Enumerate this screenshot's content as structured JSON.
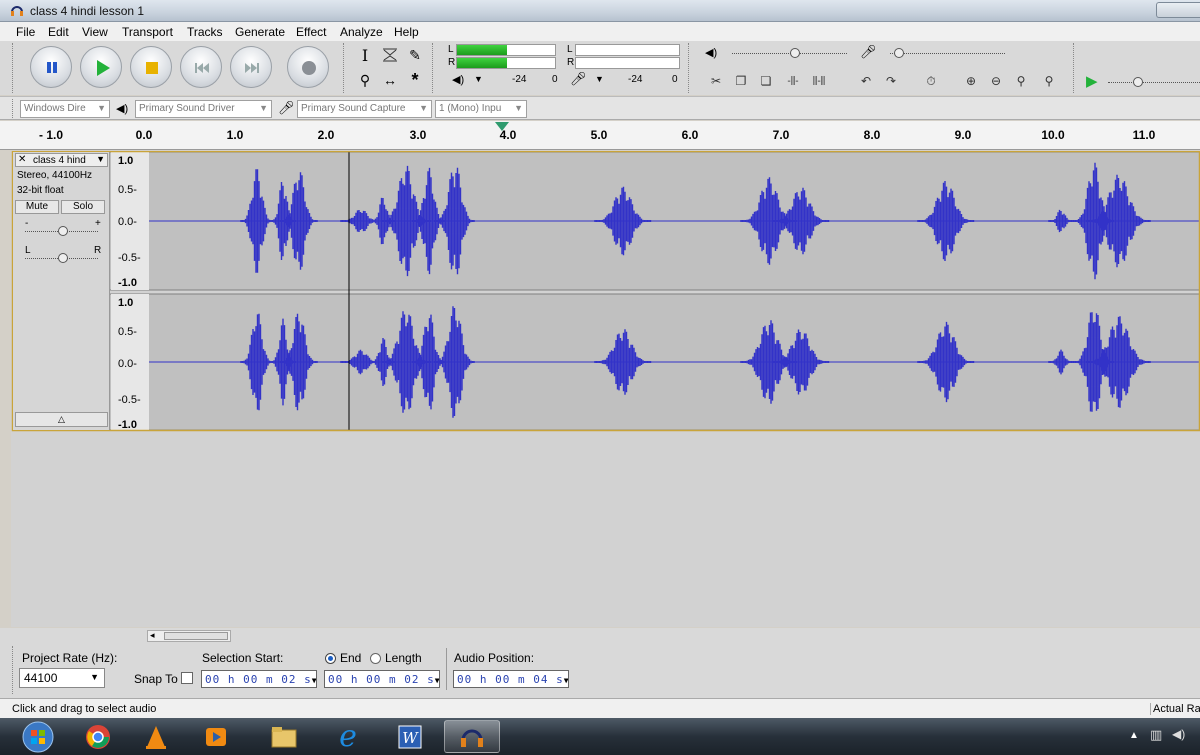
{
  "window": {
    "title": "class 4 hindi lesson 1"
  },
  "menu": [
    "File",
    "Edit",
    "View",
    "Transport",
    "Tracks",
    "Generate",
    "Effect",
    "Analyze",
    "Help"
  ],
  "meters": {
    "play_left_label": "L",
    "play_right_label": "R",
    "rec_left_label": "L",
    "rec_right_label": "R",
    "scale_a": "-24",
    "scale_b": "0",
    "scale_c": "-24",
    "scale_d": "0",
    "play_level": 0.85
  },
  "devices": {
    "host": "Windows Dire",
    "output": "Primary Sound Driver",
    "input": "Primary Sound Capture",
    "channels": "1 (Mono) Inpu"
  },
  "ruler": {
    "ticks": [
      "- 1.0",
      "0.0",
      "1.0",
      "2.0",
      "3.0",
      "4.0",
      "5.0",
      "6.0",
      "7.0",
      "8.0",
      "9.0",
      "10.0",
      "11.0"
    ]
  },
  "track": {
    "name": "class 4 hind",
    "rate": "Stereo, 44100Hz",
    "format": "32-bit float",
    "mute_label": "Mute",
    "solo_label": "Solo",
    "gain_minus": "-",
    "gain_plus": "+",
    "pan_left": "L",
    "pan_right": "R",
    "scale_labels": [
      "1.0",
      "0.5-",
      "0.0-",
      "-0.5-",
      "-1.0"
    ],
    "collapse_icon": "triangle-up-icon"
  },
  "selection": {
    "project_rate_label": "Project Rate (Hz):",
    "project_rate": "44100",
    "snap_to_label": "Snap To",
    "selection_start_label": "Selection Start:",
    "end_label": "End",
    "length_label": "Length",
    "audio_position_label": "Audio Position:",
    "start_value": "00 h 00 m 02 s",
    "end_value": "00 h 00 m 02 s",
    "position_value": "00 h 00 m 04 s"
  },
  "status": {
    "message": "Click and drag to select audio",
    "right": "Actual Ra"
  },
  "colors": {
    "waveform": "#3232c8",
    "track_bg": "#c0c0c0"
  }
}
